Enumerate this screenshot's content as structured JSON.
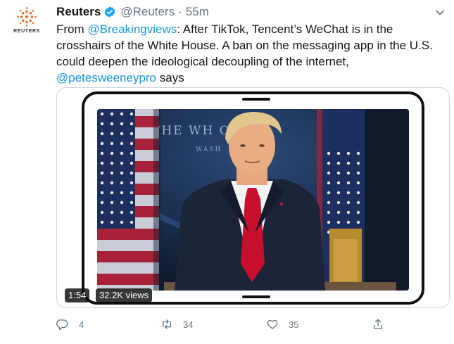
{
  "tweet": {
    "author_name": "Reuters",
    "handle": "@Reuters",
    "separator": "·",
    "time": "55m",
    "avatar_brand": "REUTERS",
    "text_prefix": "From ",
    "mention_source": "@Breakingviews",
    "text_body": ": After TikTok, Tencent’s WeChat is in the crosshairs of the White House. A ban on the messaging app in the U.S. could deepen the ideological decoupling of the internet, ",
    "mention_author": "@petesweeneypro",
    "text_suffix": " says"
  },
  "media": {
    "duration": "1:54",
    "views": "32.2K views",
    "backdrop_text_top": "THE WH   OUSE",
    "backdrop_text_bottom": "WASH"
  },
  "actions": {
    "reply_count": "4",
    "retweet_count": "34",
    "like_count": "35"
  },
  "colors": {
    "link": "#1b95e0",
    "muted": "#657786",
    "verified": "#1da1f2",
    "tie": "#c8102e"
  },
  "icons": [
    "reuters-logo-icon",
    "verified-badge-icon",
    "chevron-down-icon",
    "reply-icon",
    "retweet-icon",
    "like-icon",
    "share-icon"
  ]
}
